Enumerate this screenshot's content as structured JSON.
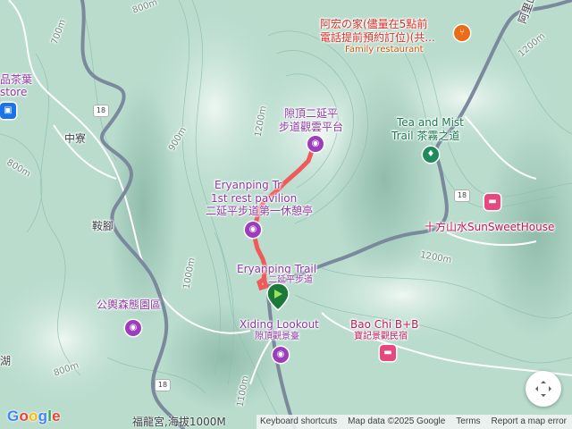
{
  "map": {
    "labels": {
      "family_restaurant_zh1": "阿宏の家(儘量在5點前",
      "family_restaurant_zh2": "電話提前預約訂位)(共...",
      "family_restaurant_en": "Family restaurant",
      "xiding_eryanping_zh1": "隙頂二延平",
      "xiding_eryanping_zh2": "步道觀雲平台",
      "tea_mist_en": "Tea and Mist",
      "tea_mist_zh": "Trail 茶霧之道",
      "village_zhongliao": "中寮",
      "village_anjiao": "鞍腳",
      "shop_en_partial": "store",
      "shop_zh_partial": "品茶葉",
      "rest_en1": "Eryanping Tr",
      "rest_en2": "1st rest pavilion",
      "rest_zh": "二延平步道第一休憩亭",
      "sunsweet": "十方山水SunSweetHouse",
      "trail_en": "Eryanping Trail",
      "trail_zh": "二延平步道",
      "gongyu": "公輿森態園區",
      "xiding_lookout_en": "Xiding Lookout",
      "xiding_lookout_zh": "隙頂觀景臺",
      "baochi_en": "Bao Chi B+B",
      "baochi_zh": "寶記景觀民宿",
      "road_partial_tr": "阿里山",
      "lake_partial": "湖",
      "contour_800": "800m",
      "contour_700": "700m",
      "contour_1200": "1200m",
      "contour_900": "900m",
      "contour_1100": "1100m",
      "contour_1000": "1000m",
      "contour_1200b": "1200m",
      "contour_1200c": "1200m",
      "route_18": "18",
      "alt_label": "福龍宮,海拔1000M"
    },
    "icons": {
      "restaurant": "fork-knife-icon",
      "viewpoint": "camera-icon",
      "hiking": "hiking-icon",
      "lodging": "bed-icon",
      "shopping": "shopping-bag-icon",
      "start_marker": "trail-start-pin",
      "fullscreen": "fullscreen-icon"
    },
    "colors": {
      "route_line": "#f05a5a",
      "terrain": "#b9dccd",
      "road": "#ffffff",
      "major_road": "#7a8a9c"
    }
  },
  "footer": {
    "shortcuts": "Keyboard shortcuts",
    "data": "Map data ©2025 Google",
    "terms": "Terms",
    "report": "Report a map error"
  }
}
